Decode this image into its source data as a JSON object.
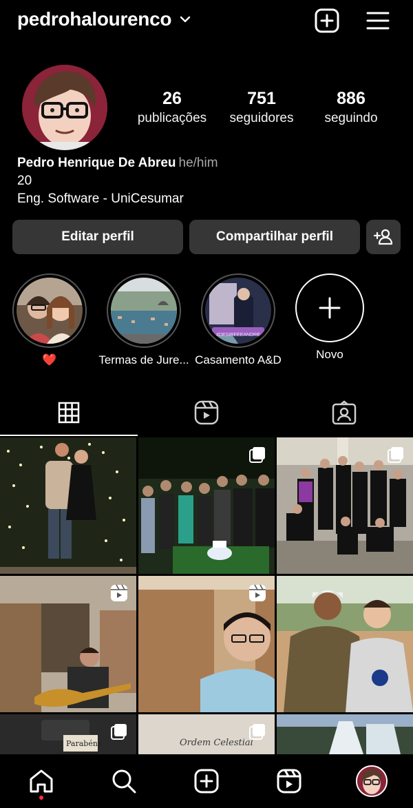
{
  "header": {
    "username": "pedrohalourenco"
  },
  "profile": {
    "stats": [
      {
        "value": "26",
        "label": "publicações"
      },
      {
        "value": "751",
        "label": "seguidores"
      },
      {
        "value": "886",
        "label": "seguindo"
      }
    ],
    "name": "Pedro Henrique De Abreu",
    "pronouns": "he/him",
    "bio_line1": "20",
    "bio_line2": "Eng. Software - UniCesumar"
  },
  "actions": {
    "edit": "Editar perfil",
    "share": "Compartilhar perfil"
  },
  "highlights": [
    {
      "label": "❤️"
    },
    {
      "label": "Termas de Jure..."
    },
    {
      "label": "Casamento A&D"
    },
    {
      "label": "Novo"
    }
  ],
  "highlight_3_sticker": "#DESIREEEANDRE",
  "grid": {
    "post_7_text": "Parabéns",
    "post_8_text": "Ordem Celestial"
  },
  "colors": {
    "background": "#000000",
    "button": "#363636",
    "notification": "#ff3040"
  }
}
